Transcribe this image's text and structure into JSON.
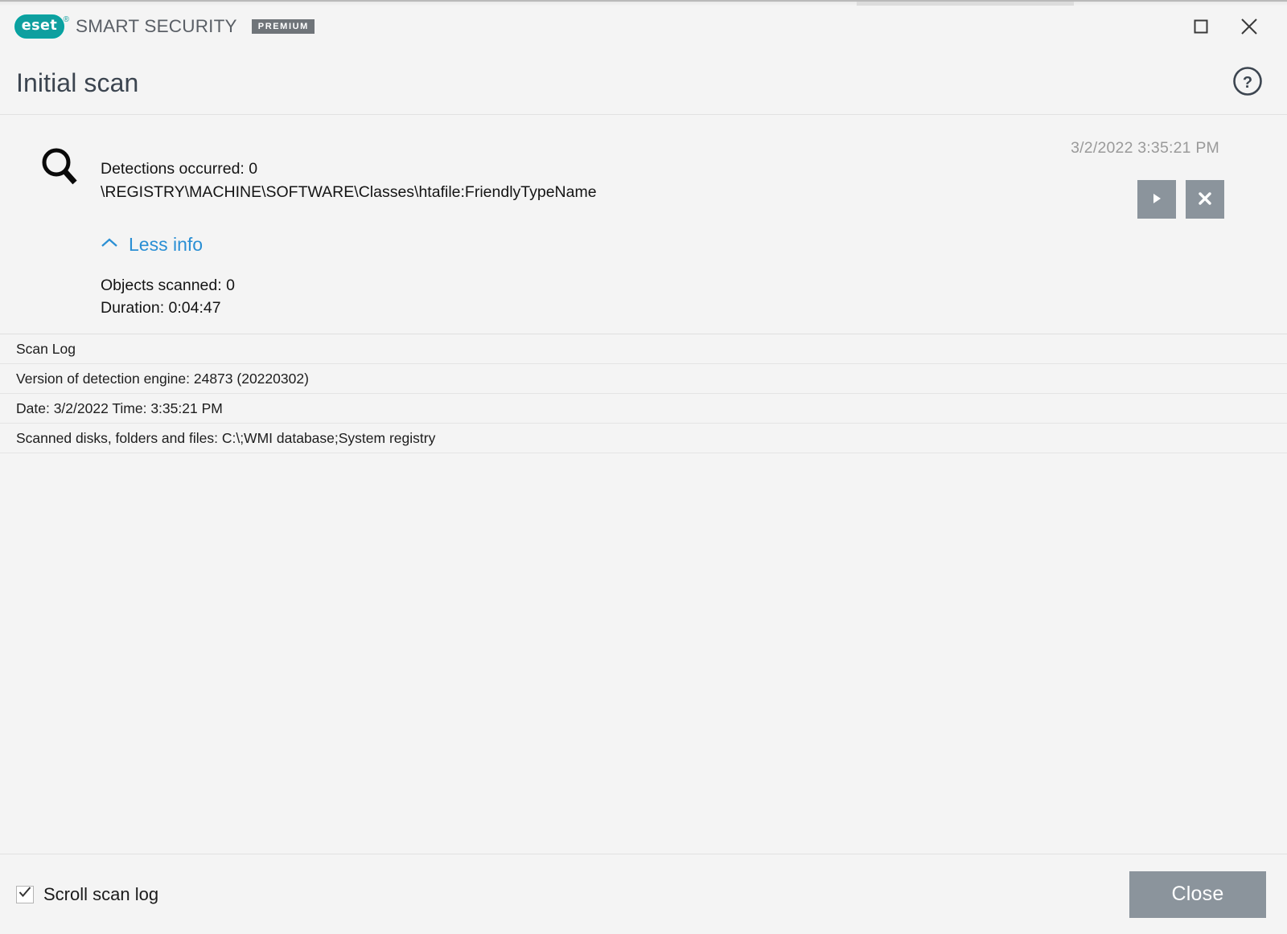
{
  "titlebar": {
    "logo_word": "eset",
    "logo_registered": "®",
    "suite_name": "SMART SECURITY",
    "edition_badge": "PREMIUM",
    "maximize_icon": "maximize-icon",
    "close_icon": "close-icon"
  },
  "header": {
    "title": "Initial scan",
    "help_icon": "help-circle-icon"
  },
  "summary": {
    "scan_icon": "magnifier-icon",
    "detections": "Detections occurred: 0",
    "current_path": "\\REGISTRY\\MACHINE\\SOFTWARE\\Classes\\htafile:FriendlyTypeName",
    "toggle_label": "Less info",
    "toggle_icon": "chevron-up-icon",
    "objects_scanned": "Objects scanned: 0",
    "duration": "Duration: 0:04:47",
    "timestamp": "3/2/2022 3:35:21 PM",
    "play_icon": "play-icon",
    "stop_icon": "stop-icon"
  },
  "log": {
    "rows": [
      "Scan Log",
      "Version of detection engine: 24873 (20220302)",
      "Date: 3/2/2022  Time: 3:35:21 PM",
      "Scanned disks, folders and files: C:\\;WMI database;System registry"
    ]
  },
  "footer": {
    "scroll_label": "Scroll scan log",
    "scroll_checked": true,
    "check_icon": "checkmark-icon",
    "close_label": "Close"
  },
  "colors": {
    "accent_teal": "#0f9f9f",
    "link_blue": "#2a8fd4",
    "button_gray": "#8b949c",
    "title_slate": "#3c4550",
    "page_bg": "#f4f4f4"
  }
}
